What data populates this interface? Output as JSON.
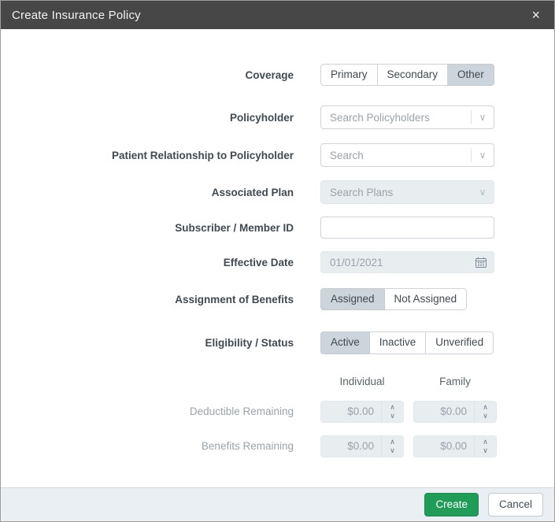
{
  "modal": {
    "title": "Create Insurance Policy",
    "close_icon": "×"
  },
  "form": {
    "coverage": {
      "label": "Coverage",
      "options": [
        "Primary",
        "Secondary",
        "Other"
      ],
      "selected": "Other"
    },
    "policyholder": {
      "label": "Policyholder",
      "placeholder": "Search Policyholders"
    },
    "patient_relationship": {
      "label": "Patient Relationship to Policyholder",
      "placeholder": "Search"
    },
    "associated_plan": {
      "label": "Associated Plan",
      "placeholder": "Search Plans",
      "disabled": true
    },
    "subscriber_id": {
      "label": "Subscriber / Member ID",
      "value": ""
    },
    "effective_date": {
      "label": "Effective Date",
      "value": "01/01/2021",
      "disabled": true
    },
    "assignment": {
      "label": "Assignment of Benefits",
      "options": [
        "Assigned",
        "Not Assigned"
      ],
      "selected": "Assigned"
    },
    "eligibility": {
      "label": "Eligibility / Status",
      "options": [
        "Active",
        "Inactive",
        "Unverified"
      ],
      "selected": "Active"
    },
    "columns": {
      "individual": "Individual",
      "family": "Family"
    },
    "deductible_remaining": {
      "label": "Deductible Remaining",
      "individual": "$0.00",
      "family": "$0.00"
    },
    "benefits_remaining": {
      "label": "Benefits Remaining",
      "individual": "$0.00",
      "family": "$0.00"
    }
  },
  "footer": {
    "create_label": "Create",
    "cancel_label": "Cancel"
  },
  "icons": {
    "chevron_down": "∨",
    "spinner_up": "∧",
    "spinner_down": "∨"
  },
  "colors": {
    "header_bg": "#474747",
    "selected_segment_bg": "#ccd5db",
    "disabled_field_bg": "#e8edf0",
    "footer_bg": "#e9eff2",
    "create_button_green": "#1f9d58",
    "label_text": "#3f4a52",
    "placeholder_text": "#9aa3ab"
  }
}
